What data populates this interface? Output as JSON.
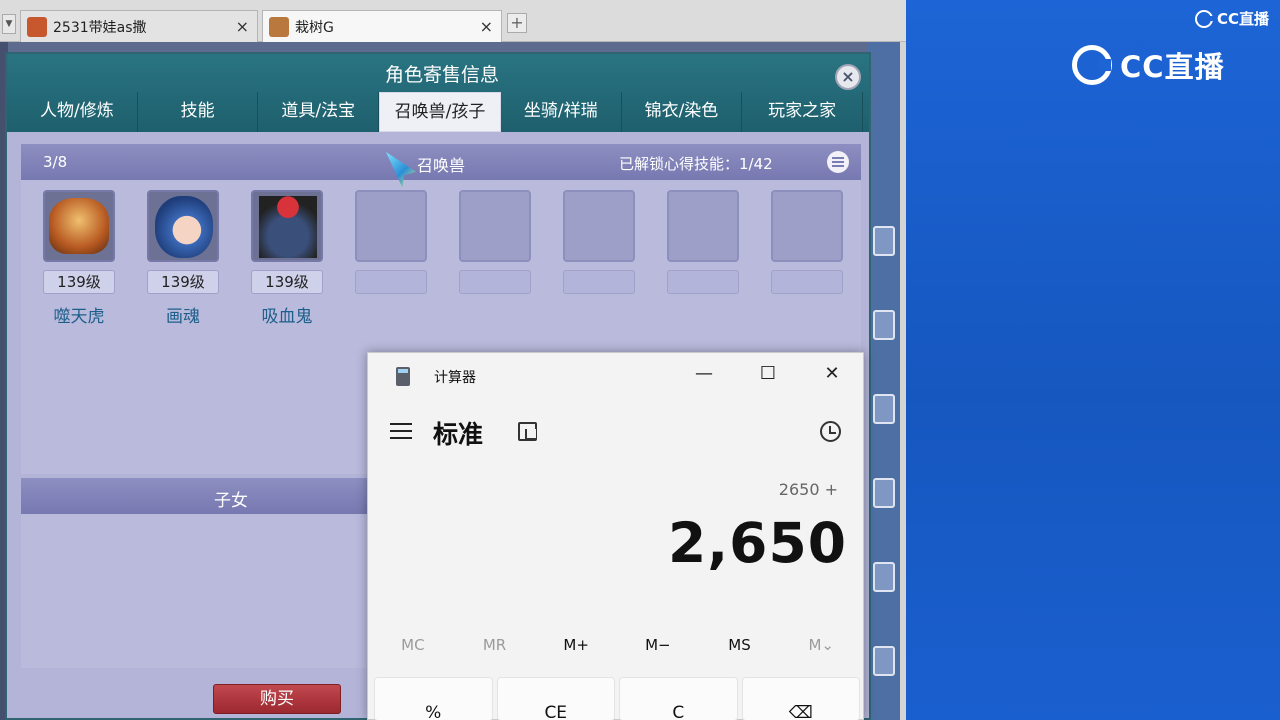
{
  "browser": {
    "tabs": [
      {
        "title": "2531带娃as撒",
        "active": false
      },
      {
        "title": "栽树G",
        "active": true
      }
    ],
    "new_tab_label": "+",
    "close_glyph": "×"
  },
  "dialog": {
    "title": "角色寄售信息",
    "close_glyph": "×",
    "tabs": [
      "人物/修炼",
      "技能",
      "道具/法宝",
      "召唤兽/孩子",
      "坐骑/祥瑞",
      "锦衣/染色",
      "玩家之家"
    ],
    "active_tab": "召唤兽/孩子",
    "pets": {
      "count": "3/8",
      "heading": "召唤兽",
      "skills_unlocked": "已解锁心得技能：1/42",
      "items": [
        {
          "level": "139级",
          "name": "噬天虎"
        },
        {
          "level": "139级",
          "name": "画魂"
        },
        {
          "level": "139级",
          "name": "吸血鬼"
        }
      ],
      "empty_slots": 5
    },
    "kids": {
      "heading": "子女"
    },
    "buy_button": "购买"
  },
  "calculator": {
    "title": "计算器",
    "mode": "标准",
    "window_controls": {
      "minimize": "—",
      "maximize": "☐",
      "close": "✕"
    },
    "expression": "2650 +",
    "display": "2,650",
    "memory_buttons": [
      {
        "label": "MC",
        "enabled": false
      },
      {
        "label": "MR",
        "enabled": false
      },
      {
        "label": "M+",
        "enabled": true
      },
      {
        "label": "M−",
        "enabled": true
      },
      {
        "label": "MS",
        "enabled": true
      },
      {
        "label": "M⌄",
        "enabled": false
      }
    ],
    "keys": [
      "%",
      "CE",
      "C",
      "⌫"
    ]
  },
  "overlay": {
    "brand": "CC直播"
  },
  "colors": {
    "dialog_header": "#1e5f6d",
    "panel_bg": "#b9badc",
    "buy_red": "#a82f37",
    "right_blue": "#1d64d6"
  }
}
